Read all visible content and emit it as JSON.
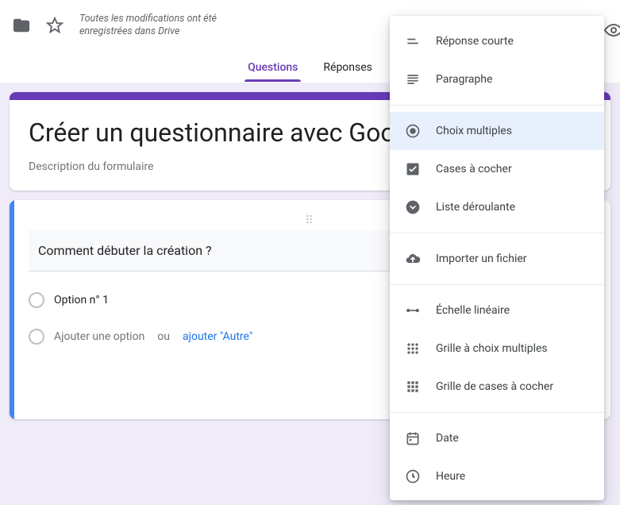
{
  "topbar": {
    "save_status": "Toutes les modifications ont été enregistrées dans Drive"
  },
  "tabs": {
    "questions": "Questions",
    "responses": "Réponses"
  },
  "form": {
    "title": "Créer un questionnaire avec Goo",
    "description": "Description du formulaire"
  },
  "question": {
    "text": "Comment débuter la création ?",
    "option1": "Option n° 1",
    "add_option": "Ajouter une option",
    "or": "ou",
    "add_other": "ajouter \"Autre\""
  },
  "menu": {
    "short_answer": "Réponse courte",
    "paragraph": "Paragraphe",
    "multiple_choice": "Choix multiples",
    "checkboxes": "Cases à cocher",
    "dropdown": "Liste déroulante",
    "file_upload": "Importer un fichier",
    "linear_scale": "Échelle linéaire",
    "mc_grid": "Grille à choix multiples",
    "cb_grid": "Grille de cases à cocher",
    "date": "Date",
    "time": "Heure"
  }
}
